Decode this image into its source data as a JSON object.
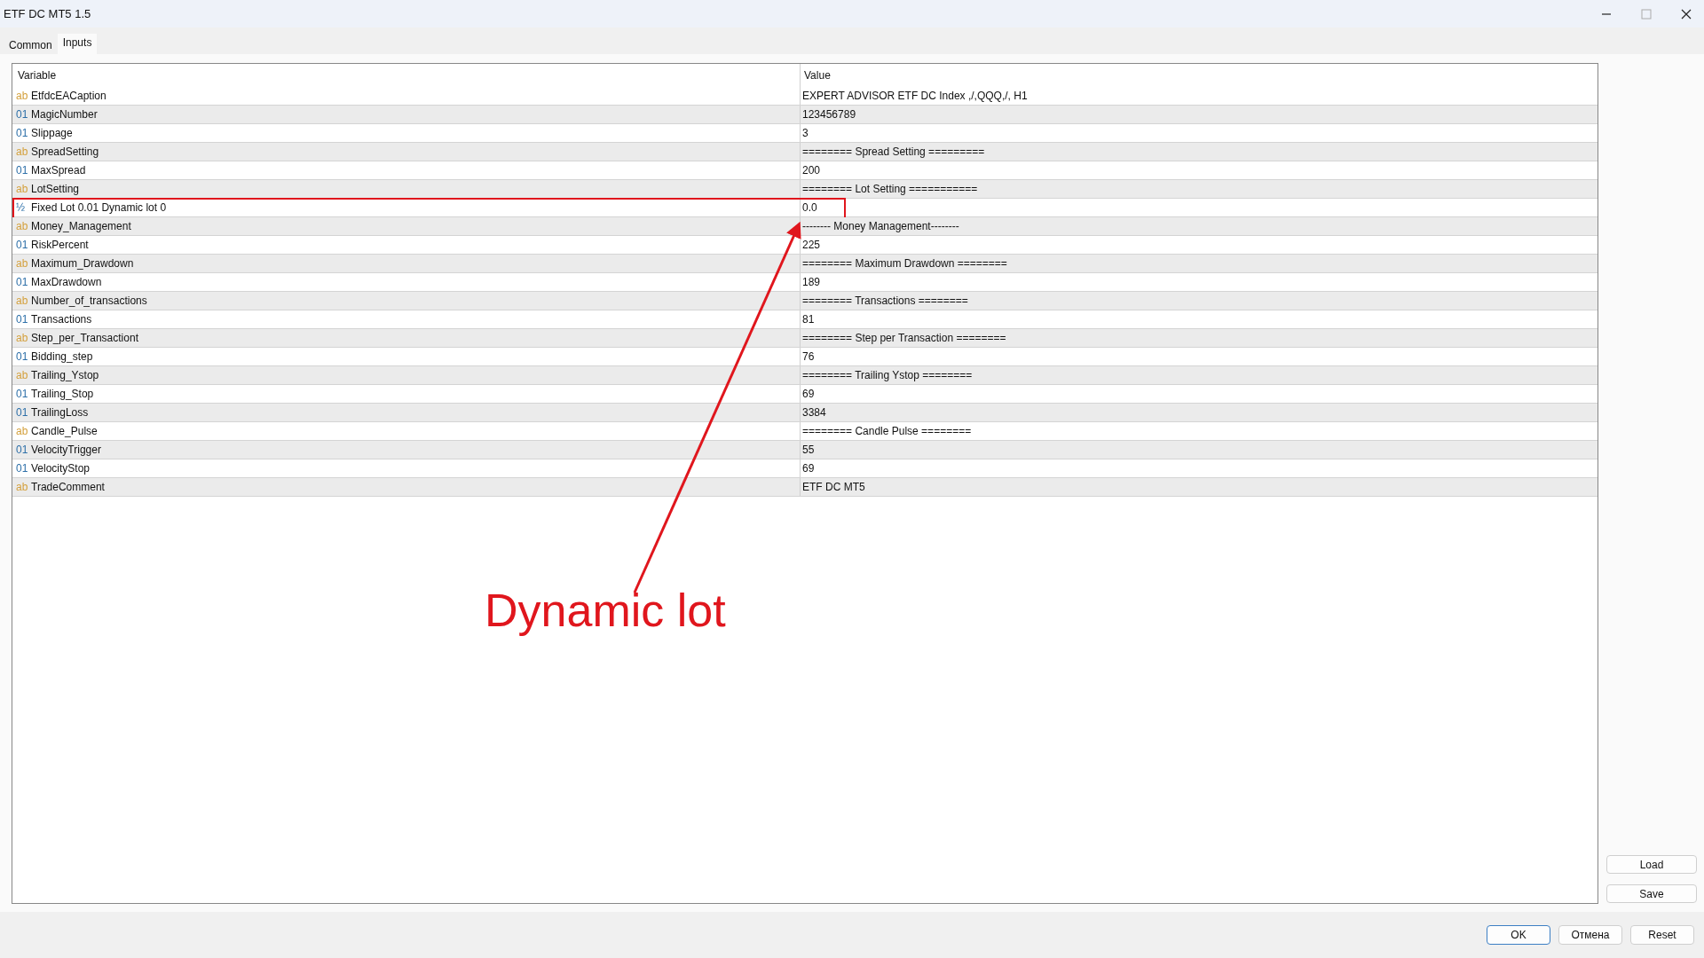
{
  "window": {
    "title": "ETF DC MT5 1.5"
  },
  "tabs": [
    {
      "label": "Common",
      "selected": false
    },
    {
      "label": "Inputs",
      "selected": true
    }
  ],
  "table": {
    "columns": [
      "Variable",
      "Value"
    ],
    "rows": [
      {
        "kind": "string",
        "type_icon": "ab",
        "variable": "EtfdcEACaption",
        "value": "EXPERT ADVISOR ETF DC Index ,/,QQQ,/, H1",
        "highlighted": false
      },
      {
        "kind": "int",
        "type_icon": "01",
        "variable": "MagicNumber",
        "value": "123456789",
        "highlighted": false
      },
      {
        "kind": "int",
        "type_icon": "01",
        "variable": "Slippage",
        "value": "3",
        "highlighted": false
      },
      {
        "kind": "string",
        "type_icon": "ab",
        "variable": "SpreadSetting",
        "value": "======== Spread Setting =========",
        "highlighted": false
      },
      {
        "kind": "int",
        "type_icon": "01",
        "variable": "MaxSpread",
        "value": "200",
        "highlighted": false
      },
      {
        "kind": "string",
        "type_icon": "ab",
        "variable": "LotSetting",
        "value": "======== Lot Setting ===========",
        "highlighted": false
      },
      {
        "kind": "double",
        "type_icon": "½",
        "variable": "Fixed Lot 0.01 Dynamic lot 0",
        "value": "0.0",
        "highlighted": true
      },
      {
        "kind": "string",
        "type_icon": "ab",
        "variable": "Money_Management",
        "value": "-------- Money Management--------",
        "highlighted": false
      },
      {
        "kind": "int",
        "type_icon": "01",
        "variable": "RiskPercent",
        "value": "225",
        "highlighted": false
      },
      {
        "kind": "string",
        "type_icon": "ab",
        "variable": "Maximum_Drawdown",
        "value": "======== Maximum Drawdown ========",
        "highlighted": false
      },
      {
        "kind": "int",
        "type_icon": "01",
        "variable": "MaxDrawdown",
        "value": "189",
        "highlighted": false
      },
      {
        "kind": "string",
        "type_icon": "ab",
        "variable": "Number_of_transactions",
        "value": "======== Transactions ========",
        "highlighted": false
      },
      {
        "kind": "int",
        "type_icon": "01",
        "variable": "Transactions",
        "value": "81",
        "highlighted": false
      },
      {
        "kind": "string",
        "type_icon": "ab",
        "variable": "Step_per_Transactiont",
        "value": "======== Step per Transaction ========",
        "highlighted": false
      },
      {
        "kind": "int",
        "type_icon": "01",
        "variable": "Bidding_step",
        "value": "76",
        "highlighted": false
      },
      {
        "kind": "string",
        "type_icon": "ab",
        "variable": "Trailing_Ystop",
        "value": "======== Trailing Ystop ========",
        "highlighted": false
      },
      {
        "kind": "int",
        "type_icon": "01",
        "variable": "Trailing_Stop",
        "value": "69",
        "highlighted": false
      },
      {
        "kind": "int",
        "type_icon": "01",
        "variable": "TrailingLoss",
        "value": "3384",
        "highlighted": false
      },
      {
        "kind": "string",
        "type_icon": "ab",
        "variable": "Candle_Pulse",
        "value": "======== Candle Pulse ========",
        "highlighted": false
      },
      {
        "kind": "int",
        "type_icon": "01",
        "variable": "VelocityTrigger",
        "value": "55",
        "highlighted": false
      },
      {
        "kind": "int",
        "type_icon": "01",
        "variable": "VelocityStop",
        "value": "69",
        "highlighted": false
      },
      {
        "kind": "string",
        "type_icon": "ab",
        "variable": "TradeComment",
        "value": "ETF DC MT5",
        "highlighted": false
      }
    ]
  },
  "side_buttons": [
    "Load",
    "Save"
  ],
  "footer_buttons": [
    {
      "label": "OK",
      "default": true
    },
    {
      "label": "Отмена",
      "default": false
    },
    {
      "label": "Reset",
      "default": false
    }
  ],
  "annotation": {
    "label": "Dynamic lot"
  }
}
